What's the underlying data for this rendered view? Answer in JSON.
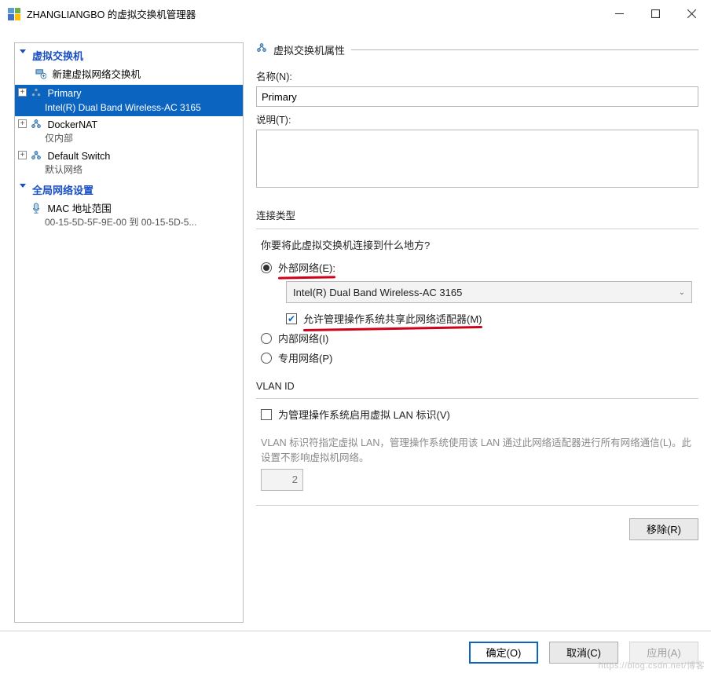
{
  "window": {
    "title": "ZHANGLIANGBO 的虚拟交换机管理器"
  },
  "sidebar": {
    "section_switches": "虚拟交换机",
    "new_switch": "新建虚拟网络交换机",
    "items": [
      {
        "name": "Primary",
        "detail": "Intel(R) Dual Band Wireless-AC 3165",
        "expander": "+"
      },
      {
        "name": "DockerNAT",
        "detail": "仅内部",
        "expander": "+"
      },
      {
        "name": "Default Switch",
        "detail": "默认网络",
        "expander": "+"
      }
    ],
    "section_global": "全局网络设置",
    "global": {
      "name": "MAC 地址范围",
      "detail": "00-15-5D-5F-9E-00 到 00-15-5D-5..."
    }
  },
  "props": {
    "header": "虚拟交换机属性",
    "name_label": "名称(N):",
    "name_value": "Primary",
    "desc_label": "说明(T):",
    "desc_value": ""
  },
  "connection": {
    "group_title": "连接类型",
    "prompt": "你要将此虚拟交换机连接到什么地方?",
    "external_label": "外部网络(E):",
    "adapter": "Intel(R) Dual Band Wireless-AC 3165",
    "share_label": "允许管理操作系统共享此网络适配器(M)",
    "internal_label": "内部网络(I)",
    "private_label": "专用网络(P)"
  },
  "vlan": {
    "group_title": "VLAN ID",
    "enable_label": "为管理操作系统启用虚拟 LAN 标识(V)",
    "desc": "VLAN 标识符指定虚拟 LAN，管理操作系统使用该 LAN 通过此网络适配器进行所有网络通信(L)。此设置不影响虚拟机网络。",
    "value": "2"
  },
  "buttons": {
    "remove": "移除(R)",
    "ok": "确定(O)",
    "cancel": "取消(C)",
    "apply": "应用(A)"
  },
  "watermark": "https://blog.csdn.net/博客"
}
